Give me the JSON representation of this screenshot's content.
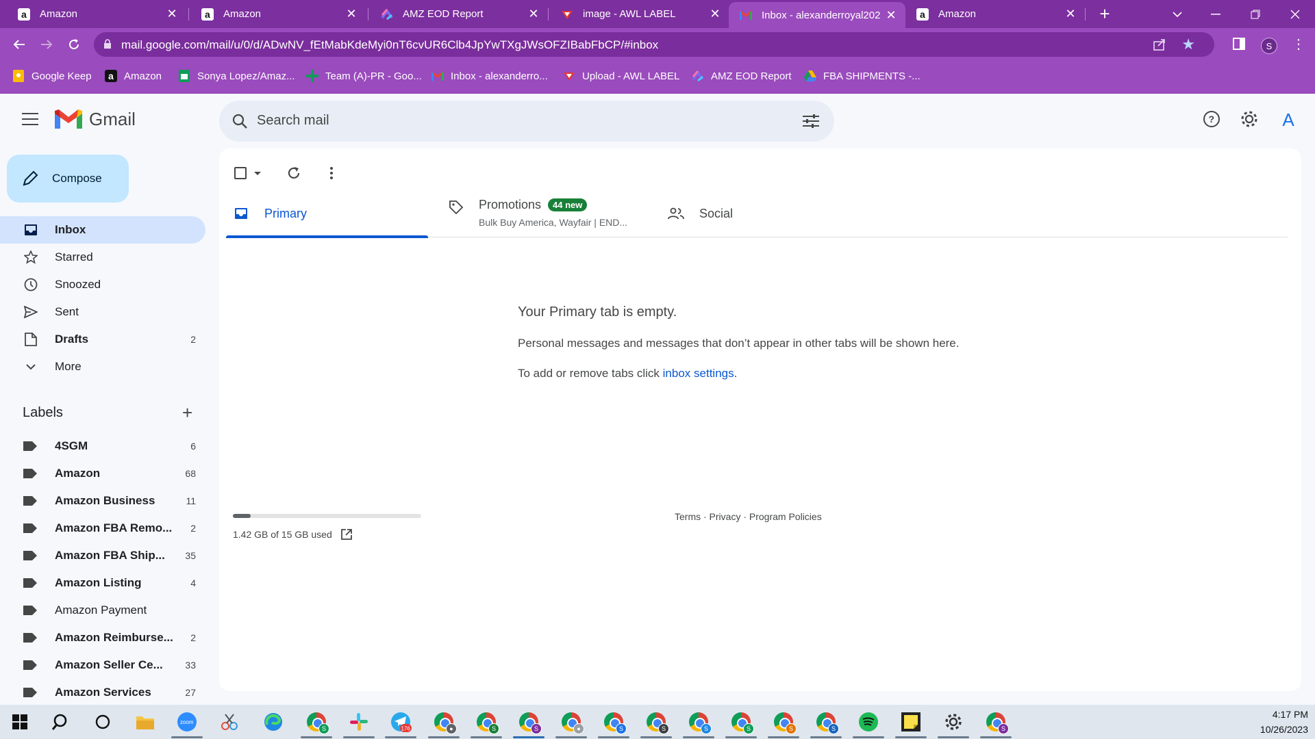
{
  "browser": {
    "tabs": [
      {
        "title": "Amazon",
        "favicon": "amazon-icon",
        "active": false
      },
      {
        "title": "Amazon",
        "favicon": "amazon-icon",
        "active": false
      },
      {
        "title": "AMZ EOD Report",
        "favicon": "clickup-icon",
        "active": false
      },
      {
        "title": "image - AWL LABEL",
        "favicon": "awl-icon",
        "active": false
      },
      {
        "title": "Inbox - alexanderroyal202",
        "favicon": "gmail-icon",
        "active": true
      },
      {
        "title": "Amazon",
        "favicon": "amazon-icon",
        "active": false
      }
    ],
    "url": "mail.google.com/mail/u/0/d/ADwNV_fEtMabKdeMyi0nT6cvUR6Clb4JpYwTXgJWsOFZIBabFbCP/#inbox",
    "profile_initial": "S",
    "bookmarks": [
      {
        "label": "Google Keep",
        "icon": "keep-icon"
      },
      {
        "label": "Amazon",
        "icon": "amazon-icon"
      },
      {
        "label": "Sonya Lopez/Amaz...",
        "icon": "sheets-icon"
      },
      {
        "label": "Team (A)-PR - Goo...",
        "icon": "sheets-plus-icon"
      },
      {
        "label": "Inbox - alexanderro...",
        "icon": "gmail-icon"
      },
      {
        "label": "Upload - AWL LABEL",
        "icon": "awl-icon"
      },
      {
        "label": "AMZ EOD Report",
        "icon": "clickup-icon"
      },
      {
        "label": "FBA SHIPMENTS -...",
        "icon": "drive-icon"
      }
    ]
  },
  "gmail": {
    "brand": "Gmail",
    "search_placeholder": "Search mail",
    "avatar_initial": "A",
    "compose_label": "Compose",
    "nav": [
      {
        "label": "Inbox",
        "icon": "inbox-icon",
        "count": "",
        "active": true
      },
      {
        "label": "Starred",
        "icon": "star-icon",
        "count": ""
      },
      {
        "label": "Snoozed",
        "icon": "clock-icon",
        "count": ""
      },
      {
        "label": "Sent",
        "icon": "send-icon",
        "count": ""
      },
      {
        "label": "Drafts",
        "icon": "draft-icon",
        "count": "2"
      },
      {
        "label": "More",
        "icon": "chevron-down-icon",
        "count": ""
      }
    ],
    "labels_heading": "Labels",
    "labels": [
      {
        "name": "4SGM",
        "count": "6",
        "bold": true
      },
      {
        "name": "Amazon",
        "count": "68",
        "bold": true
      },
      {
        "name": "Amazon Business",
        "count": "11",
        "bold": true
      },
      {
        "name": "Amazon FBA Remo...",
        "count": "2",
        "bold": true
      },
      {
        "name": "Amazon FBA Ship...",
        "count": "35",
        "bold": true
      },
      {
        "name": "Amazon Listing",
        "count": "4",
        "bold": true
      },
      {
        "name": "Amazon Payment",
        "count": "",
        "bold": false
      },
      {
        "name": "Amazon Reimburse...",
        "count": "2",
        "bold": true
      },
      {
        "name": "Amazon Seller Ce...",
        "count": "33",
        "bold": true
      },
      {
        "name": "Amazon Services",
        "count": "27",
        "bold": true
      }
    ],
    "inbox_tabs": {
      "primary": "Primary",
      "promotions": "Promotions",
      "promotions_badge": "44 new",
      "promotions_sub": "Bulk Buy America, Wayfair | END...",
      "social": "Social"
    },
    "empty_state": {
      "title": "Your Primary tab is empty.",
      "description": "Personal messages and messages that don’t appear in other tabs will be shown here.",
      "tip_prefix": "To add or remove tabs click ",
      "tip_link": "inbox settings",
      "tip_suffix": "."
    },
    "storage": {
      "text": "1.42 GB of 15 GB used",
      "fraction_used": 0.095
    },
    "footer": "Terms · Privacy · Program Policies"
  },
  "taskbar": {
    "time": "4:17 PM",
    "date": "10/26/2023",
    "telegram_badge": "176",
    "profile_badge_letter": "S"
  },
  "colors": {
    "chrome_frame": "#7c2f9e",
    "chrome_toolbar": "#9a4bbd",
    "gmail_active_nav": "#d3e3fd",
    "gmail_accent": "#0b57d0",
    "compose_bg": "#c2e7ff",
    "promotions_badge": "#188038"
  }
}
